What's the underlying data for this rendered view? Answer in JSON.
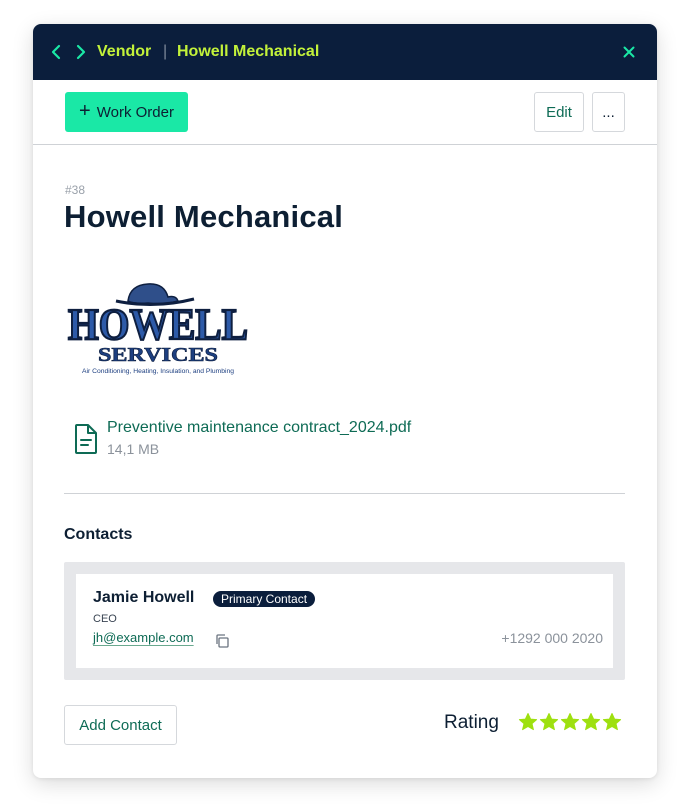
{
  "header": {
    "back_icon": "chevron-left-icon",
    "forward_icon": "chevron-right-icon",
    "breadcrumb": [
      "Vendor",
      "Howell Mechanical"
    ],
    "separator": "|",
    "close_icon": "close-icon",
    "accent_color": "#c3f23a",
    "background_color": "#0b1e3c"
  },
  "toolbar": {
    "work_order_plus": "+",
    "work_order_label": "Work Order",
    "edit_label": "Edit",
    "more_label": "..."
  },
  "vendor": {
    "id": "#38",
    "name": "Howell Mechanical",
    "logo": {
      "line1": "HOWELL",
      "line2": "SERVICES",
      "tagline": "Air Conditioning, Heating, Insulation, and Plumbing"
    }
  },
  "attachment": {
    "icon": "file-icon",
    "name": "Preventive maintenance contract_2024.pdf",
    "size": "14,1 MB"
  },
  "contacts": {
    "title": "Contacts",
    "items": [
      {
        "name": "Jamie Howell",
        "badge": "Primary Contact",
        "role": "CEO",
        "email": "jh@example.com",
        "phone": "+1292 000 2020"
      }
    ],
    "add_label": "Add Contact"
  },
  "rating": {
    "label": "Rating",
    "value": 5,
    "max": 5,
    "star_color": "#9ee010"
  }
}
